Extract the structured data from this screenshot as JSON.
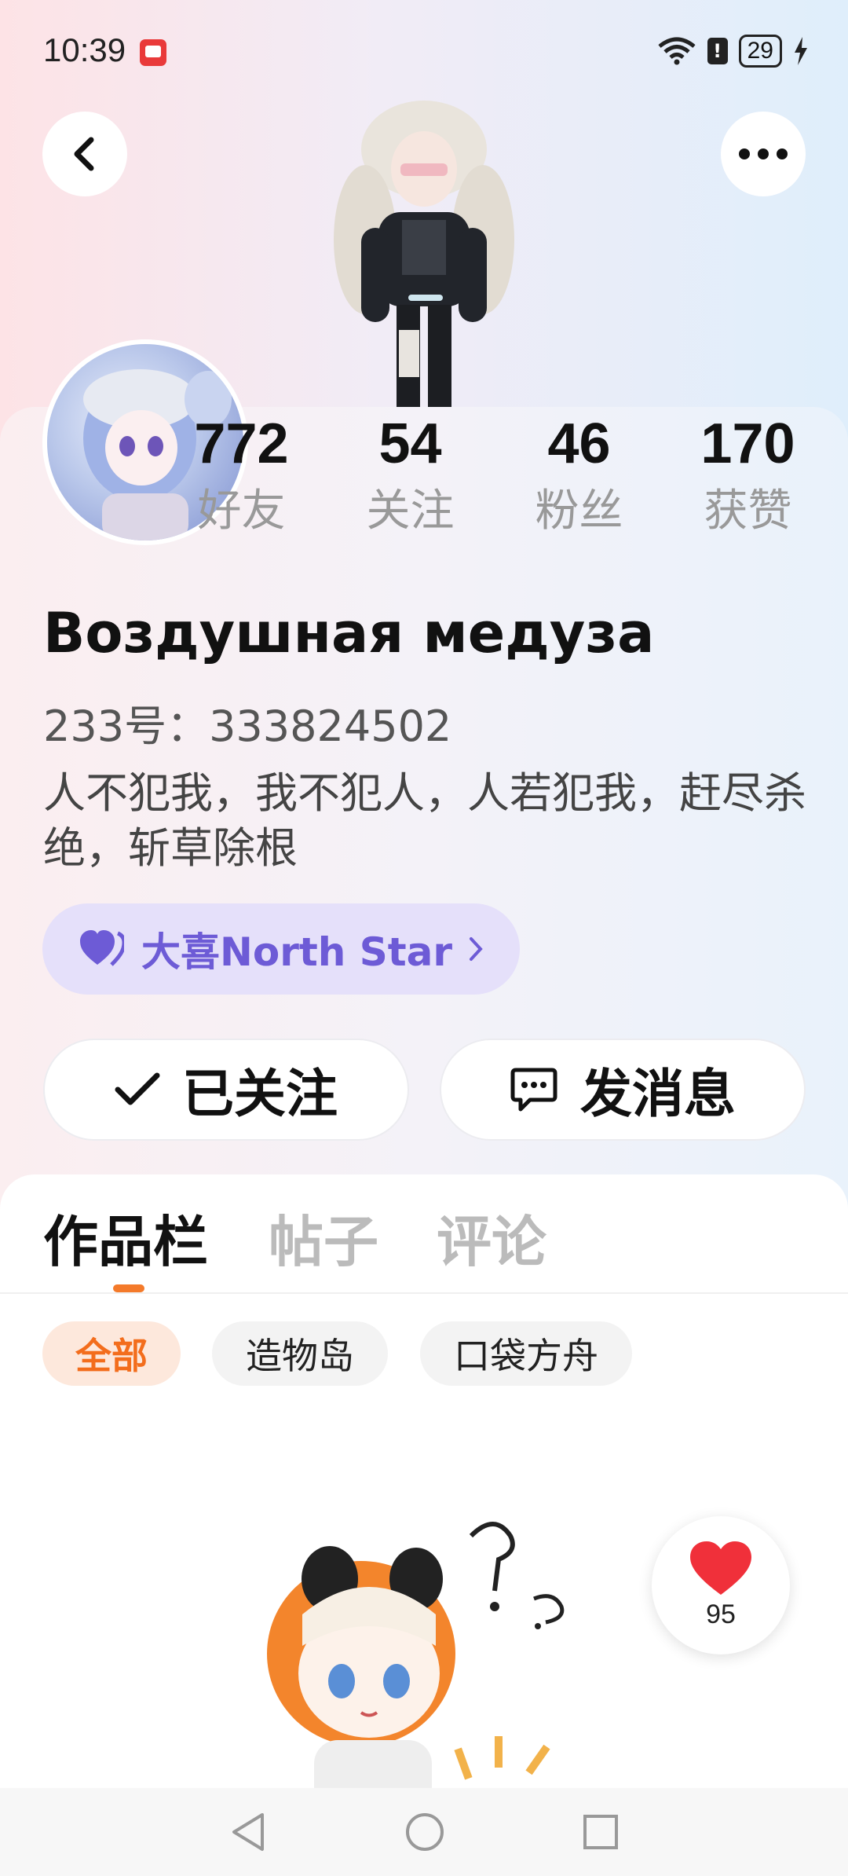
{
  "status_bar": {
    "time": "10:39",
    "battery": "29"
  },
  "stats": [
    {
      "value": "772",
      "label": "好友"
    },
    {
      "value": "54",
      "label": "关注"
    },
    {
      "value": "46",
      "label": "粉丝"
    },
    {
      "value": "170",
      "label": "获赞"
    }
  ],
  "profile": {
    "nickname": "Воздушная медуза",
    "uid": "233号：333824502",
    "bio": "人不犯我，我不犯人，人若犯我，赶尽杀绝，斩草除根",
    "badge": "大喜North Star"
  },
  "actions": {
    "follow_label": "已关注",
    "message_label": "发消息"
  },
  "tabs": [
    "作品栏",
    "帖子",
    "评论"
  ],
  "filters": [
    "全部",
    "造物岛",
    "口袋方舟"
  ],
  "like": {
    "count": "95"
  },
  "colors": {
    "accent": "#f47a2a",
    "badge_text": "#6d5bd6",
    "badge_bg": "#e5e0fa",
    "like_red": "#f0303a"
  }
}
